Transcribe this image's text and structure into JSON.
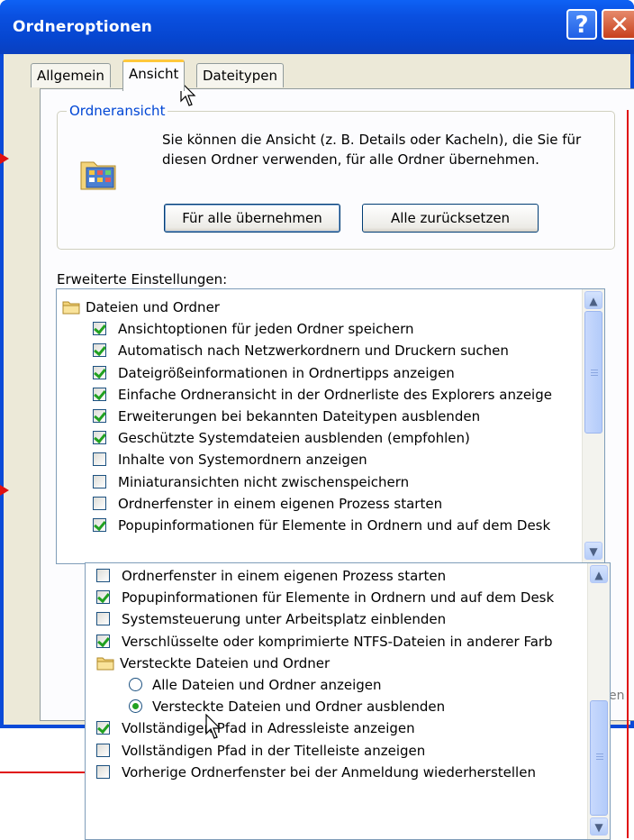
{
  "window": {
    "title": "Ordneroptionen",
    "help_glyph": "?",
    "close_glyph": "✕"
  },
  "tabs": [
    "Allgemein",
    "Ansicht",
    "Dateitypen"
  ],
  "group": {
    "legend": "Ordneransicht",
    "description": "Sie können die Ansicht (z. B. Details oder Kacheln), die Sie für diesen Ordner verwenden, für alle Ordner übernehmen.",
    "apply_all": "Für alle übernehmen",
    "reset_all": "Alle zurücksetzen"
  },
  "advanced_label": "Erweiterte Einstellungen:",
  "list_top": [
    {
      "kind": "folder",
      "label": "Dateien und Ordner"
    },
    {
      "kind": "checkbox",
      "checked": true,
      "label": "Ansichtoptionen für jeden Ordner speichern"
    },
    {
      "kind": "checkbox",
      "checked": true,
      "label": "Automatisch nach Netzwerkordnern und Druckern suchen"
    },
    {
      "kind": "checkbox",
      "checked": true,
      "label": "Dateigrößeinformationen in Ordnertipps anzeigen"
    },
    {
      "kind": "checkbox",
      "checked": true,
      "label": "Einfache Ordneransicht in der Ordnerliste des Explorers anzeige"
    },
    {
      "kind": "checkbox",
      "checked": true,
      "label": "Erweiterungen bei bekannten Dateitypen ausblenden"
    },
    {
      "kind": "checkbox",
      "checked": true,
      "label": "Geschützte Systemdateien ausblenden (empfohlen)"
    },
    {
      "kind": "checkbox",
      "checked": false,
      "label": "Inhalte von Systemordnern anzeigen"
    },
    {
      "kind": "checkbox",
      "checked": false,
      "label": "Miniaturansichten nicht zwischenspeichern"
    },
    {
      "kind": "checkbox",
      "checked": false,
      "label": "Ordnerfenster in einem eigenen Prozess starten"
    },
    {
      "kind": "checkbox",
      "checked": true,
      "label": "Popupinformationen für Elemente in Ordnern und auf dem Desk"
    }
  ],
  "list_bottom": [
    {
      "kind": "checkbox",
      "checked": false,
      "label": "Ordnerfenster in einem eigenen Prozess starten"
    },
    {
      "kind": "checkbox",
      "checked": true,
      "label": "Popupinformationen für Elemente in Ordnern und auf dem Desk"
    },
    {
      "kind": "checkbox",
      "checked": false,
      "label": "Systemsteuerung unter Arbeitsplatz einblenden"
    },
    {
      "kind": "checkbox",
      "checked": true,
      "label": "Verschlüsselte oder komprimierte NTFS-Dateien in anderer Farb"
    },
    {
      "kind": "folder",
      "label": "Versteckte Dateien und Ordner"
    },
    {
      "kind": "radio",
      "checked": false,
      "label": "Alle Dateien und Ordner anzeigen"
    },
    {
      "kind": "radio",
      "checked": true,
      "label": "Versteckte Dateien und Ordner ausblenden"
    },
    {
      "kind": "checkbox",
      "checked": true,
      "label": "Vollständigen Pfad in Adressleiste anzeigen"
    },
    {
      "kind": "checkbox",
      "checked": false,
      "label": "Vollständigen Pfad in der Titelleiste anzeigen"
    },
    {
      "kind": "checkbox",
      "checked": false,
      "label": "Vorherige Ordnerfenster bei der Anmeldung wiederherstellen"
    }
  ],
  "hidden_button_fragment": "en",
  "scroll": {
    "up_glyph": "▲",
    "down_glyph": "▼"
  },
  "colors": {
    "titlebar": "#0a50e0",
    "accent_tab": "#ffc83c",
    "annotation": "#e01010",
    "legend": "#0046d5"
  }
}
